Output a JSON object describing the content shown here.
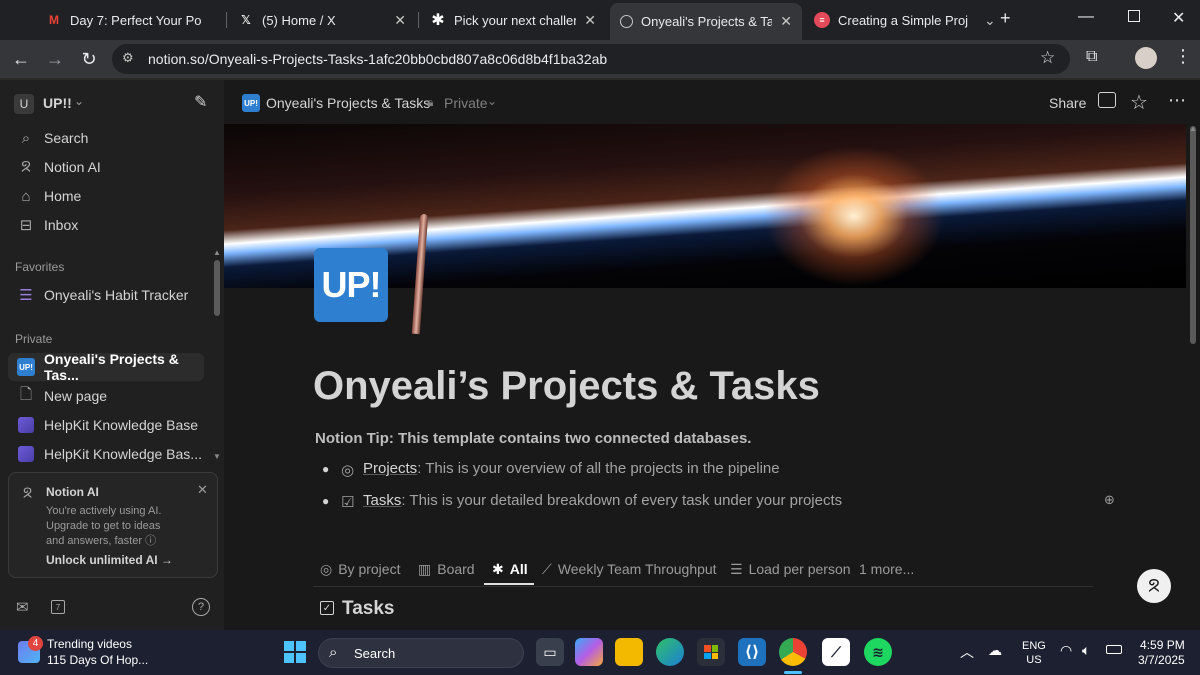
{
  "browser": {
    "tabs": [
      {
        "title": "Day 7: Perfect Your Po",
        "icon": "gmail-icon",
        "active": false
      },
      {
        "title": "(5) Home / X",
        "icon": "x-icon",
        "active": false
      },
      {
        "title": "Pick your next challenge",
        "icon": "asterisk-icon",
        "active": false
      },
      {
        "title": "Onyeali's Projects & Task",
        "icon": "notion-icon",
        "active": true
      },
      {
        "title": "Creating a Simple Project",
        "icon": "site-icon",
        "active": false
      }
    ],
    "url": "notion.so/Onyeali-s-Projects-Tasks-1afc20bb0cbd807a8c06d8b4f1ba32ab"
  },
  "sidebar": {
    "workspace_icon": "U",
    "workspace_name": "UP!!",
    "items": [
      {
        "label": "Search",
        "icon": "search-icon"
      },
      {
        "label": "Notion AI",
        "icon": "notion-ai-icon"
      },
      {
        "label": "Home",
        "icon": "home-icon"
      },
      {
        "label": "Inbox",
        "icon": "inbox-icon"
      }
    ],
    "favorites_label": "Favorites",
    "favorites": [
      {
        "label": "Onyeali's Habit Tracker"
      }
    ],
    "private_label": "Private",
    "private": [
      {
        "label": "Onyeali's Projects & Tas...",
        "selected": true
      },
      {
        "label": "New page"
      },
      {
        "label": "HelpKit Knowledge Base"
      },
      {
        "label": "HelpKit Knowledge Bas..."
      }
    ],
    "ai_card": {
      "title": "Notion AI",
      "body_1": "You're actively using AI.",
      "body_2": "Upgrade to get to ideas",
      "body_3": "and answers, faster",
      "cta": "Unlock unlimited AI →"
    }
  },
  "page": {
    "breadcrumb_icon": "UP!",
    "breadcrumb_title": "Onyeali's Projects & Tasks",
    "privacy": "Private",
    "share_label": "Share",
    "icon_text": "UP!",
    "title": "Onyeali’s Projects & Tasks",
    "tip": "Notion Tip: This template contains two connected databases.",
    "bullets": [
      {
        "link": "Projects",
        "text": ": This is your overview of all the projects in the pipeline"
      },
      {
        "link": "Tasks",
        "text": ": This is your detailed breakdown of every task under your projects"
      }
    ],
    "views": [
      {
        "label": "By project",
        "icon": "target-icon"
      },
      {
        "label": "Board",
        "icon": "board-icon"
      },
      {
        "label": "All",
        "icon": "asterisk-icon",
        "active": true
      },
      {
        "label": "Weekly Team Throughput",
        "icon": "chart-icon"
      },
      {
        "label": "Load per person",
        "icon": "bars-icon"
      },
      {
        "label": "1 more...",
        "icon": ""
      }
    ],
    "database_title": "Tasks"
  },
  "taskbar": {
    "news_title": "Trending videos",
    "news_sub": "115 Days Of Hop...",
    "news_badge": "4",
    "search_label": "Search",
    "lang_1": "ENG",
    "lang_2": "US",
    "time": "4:59 PM",
    "date": "3/7/2025"
  }
}
